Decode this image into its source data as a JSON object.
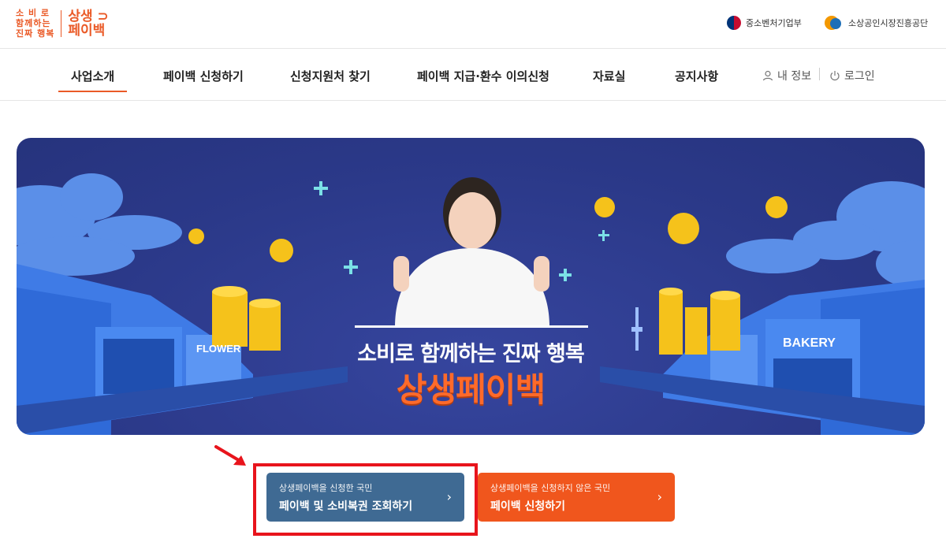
{
  "header": {
    "logo_small_line1": "소 비 로",
    "logo_small_line2": "함께하는",
    "logo_small_line3": "진짜 행복",
    "logo_big_line1": "상생",
    "logo_big_line2": "페이백",
    "org1": "중소벤처기업부",
    "org2": "소상공인시장진흥공단"
  },
  "nav": {
    "items": [
      {
        "label": "사업소개"
      },
      {
        "label": "페이백 신청하기"
      },
      {
        "label": "신청지원처 찾기"
      },
      {
        "label": "페이백 지급·환수 이의신청"
      },
      {
        "label": "자료실"
      },
      {
        "label": "공지사항"
      }
    ],
    "my_info": "내 정보",
    "login": "로그인"
  },
  "banner": {
    "subtitle": "소비로 함께하는 진짜 행복",
    "title": "상생페이백",
    "left_sign": "FLOWER",
    "right_sign": "BAKERY"
  },
  "cta": {
    "applied_small": "상생페이백을 신청한 국민",
    "applied_big": "페이백 및 소비복권 조회하기",
    "not_applied_small": "상생페이백을 신청하지 않은 국민",
    "not_applied_big": "페이백 신청하기"
  },
  "colors": {
    "brand": "#ea5a27",
    "cta_blue": "#3f6a93",
    "cta_orange": "#f0561d",
    "highlight_red": "#e8141c",
    "banner_bg": "#2b3989"
  }
}
